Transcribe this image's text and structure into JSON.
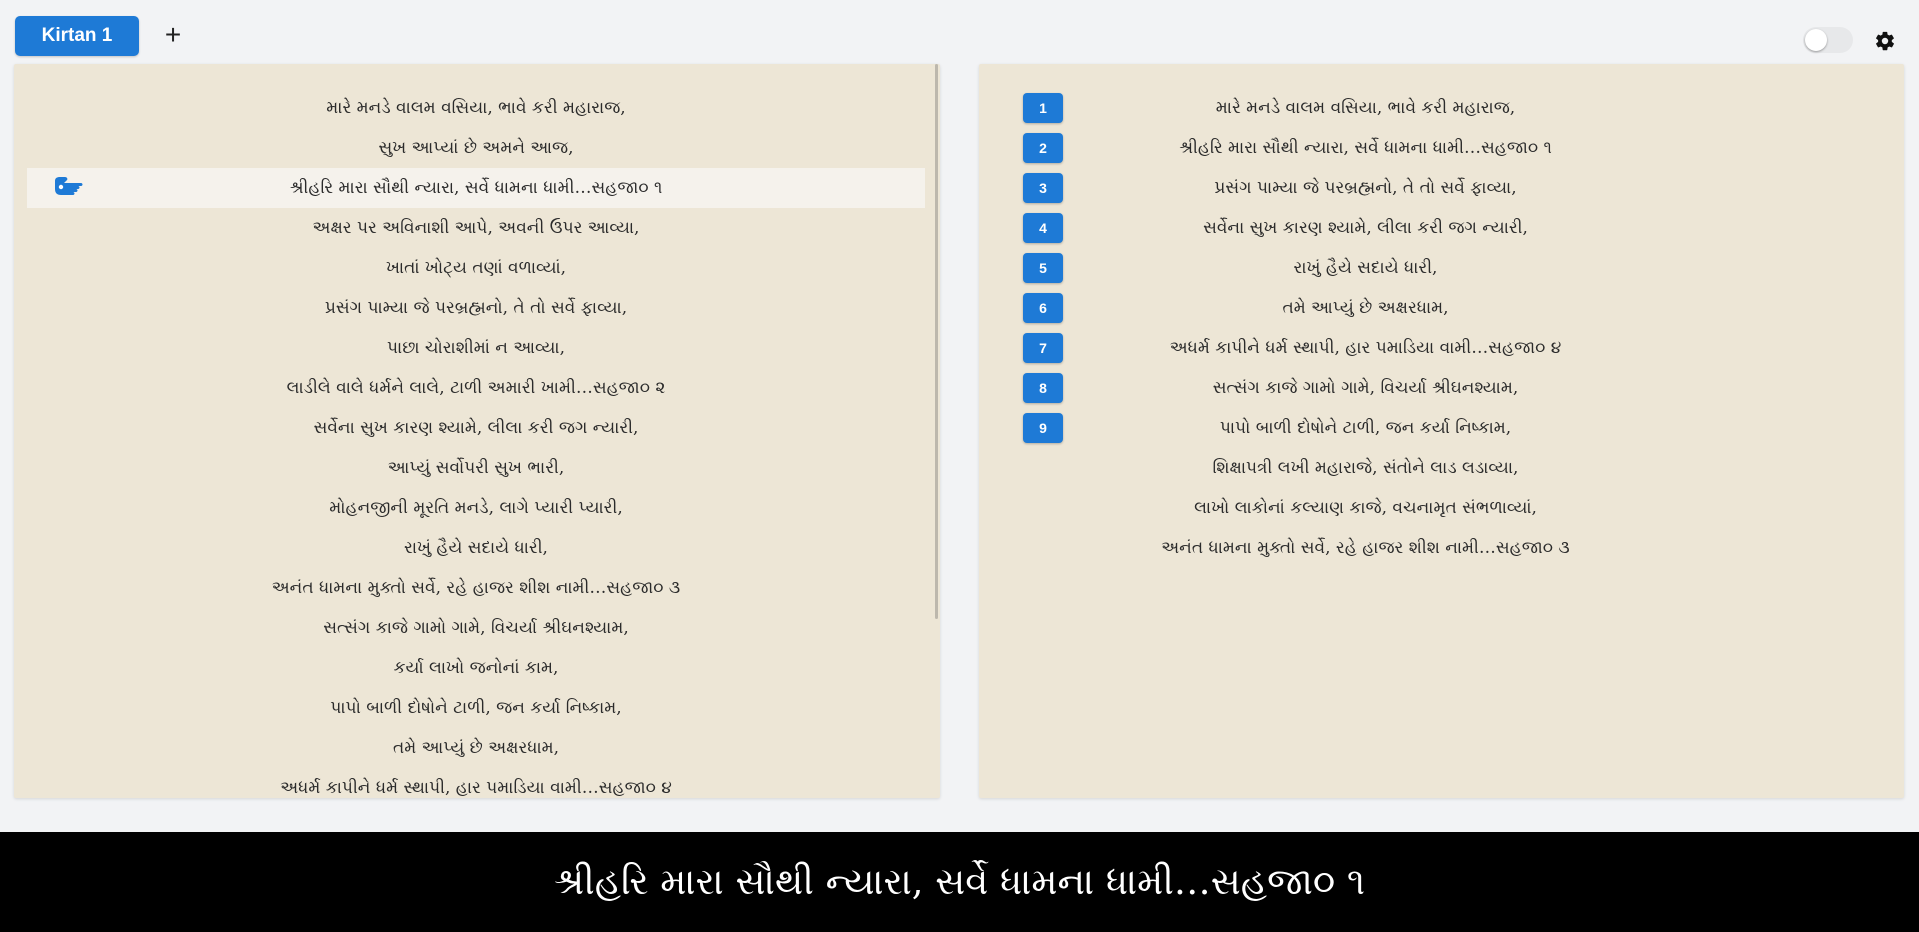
{
  "tabs": [
    {
      "label": "Kirtan 1"
    }
  ],
  "add_tab_label": "+",
  "left_lines": [
    "મારે મનડે વાલમ વસિયા, ભાવે કરી મહારાજ,",
    "સુખ આપ્યાં છે અમને આજ,",
    "શ્રીહરિ મારા સૌથી ન્યારા, સર્વે ધામના ધામી…સહજા૦ ૧",
    "અક્ષર પર અવિનાશી આપે, અવની ઉપર આવ્યા,",
    "ખાતાં ખોટ્ય તણાં વળાવ્યાં,",
    "પ્રસંગ પામ્યા જે પરબ્રહ્મનો, તે તો સર્વે ફાવ્યા,",
    "પાછા ચોરાશીમાં ન આવ્યા,",
    "લાડીલે વાલે ધર્મને લાલે, ટાળી અમારી ખામી…સહજા૦ ૨",
    "સર્વેના સુખ કારણ શ્યામે, લીલા કરી જગ ન્યારી,",
    "આપ્યું સર્વોપરી સુખ ભારી,",
    "મોહનજીની મૂરતિ મનડે, લાગે પ્યારી પ્યારી,",
    "રાખું હૈયે સદાયે ધારી,",
    "અનંત ધામના મુક્તો સર્વે, રહે હાજર શીશ નામી…સહજા૦ ૩",
    "સત્સંગ કાજે ગામો ગામે, વિચર્યા શ્રીઘનશ્યામ,",
    "કર્યા લાખો જનોનાં કામ,",
    "પાપો બાળી દોષોને ટાળી, જન કર્યા નિષ્કામ,",
    "તમે આપ્યું છે અક્ષરધામ,",
    "અધર્મ કાપીને ધર્મ સ્થાપી, હાર પમાડિયા વામી…સહજા૦ ૪"
  ],
  "active_index": 2,
  "right_lines": [
    {
      "num": "1",
      "text": "મારે મનડે વાલમ વસિયા, ભાવે કરી મહારાજ,"
    },
    {
      "num": "2",
      "text": "શ્રીહરિ મારા સૌથી ન્યારા, સર્વે ધામના ધામી…સહજા૦ ૧"
    },
    {
      "num": "3",
      "text": "પ્રસંગ પામ્યા જે પરબ્રહ્મનો, તે તો સર્વે ફાવ્યા,"
    },
    {
      "num": "4",
      "text": "સર્વેના સુખ કારણ શ્યામે, લીલા કરી જગ ન્યારી,"
    },
    {
      "num": "5",
      "text": "રાખું હૈયે સદાયે ધારી,"
    },
    {
      "num": "6",
      "text": "તમે આપ્યું છે અક્ષરધામ,"
    },
    {
      "num": "7",
      "text": "અધર્મ કાપીને ધર્મ સ્થાપી, હાર પમાડિયા વામી…સહજા૦ ૪"
    },
    {
      "num": "8",
      "text": "સત્સંગ કાજે ગામો ગામે, વિચર્યા શ્રીઘનશ્યામ,"
    },
    {
      "num": "9",
      "text": "પાપો બાળી દોષોને ટાળી, જન કર્યા નિષ્કામ,"
    },
    {
      "num": "",
      "text": "શિક્ષાપત્રી લખી મહારાજે, સંતોને લાડ લડાવ્યા,"
    },
    {
      "num": "",
      "text": "લાખો લાકોનાં કલ્યાણ કાજે, વચનામૃત સંભળાવ્યાં,"
    },
    {
      "num": "",
      "text": "અનંત ધામના મુક્તો સર્વે, રહે હાજર શીશ નામી…સહજા૦ ૩"
    }
  ],
  "footer_text": "શ્રીહરિ મારા સૌથી ન્યારા, સર્વે ધામના ધામી…સહજા૦ ૧",
  "toggle_on": false,
  "icons": {
    "pointer": "pointing-hand-icon",
    "settings": "gear-icon"
  },
  "colors": {
    "accent": "#1e7ad6",
    "panel": "#ede6d6",
    "active_row": "#f5f2ec",
    "footer_bg": "#000000"
  }
}
